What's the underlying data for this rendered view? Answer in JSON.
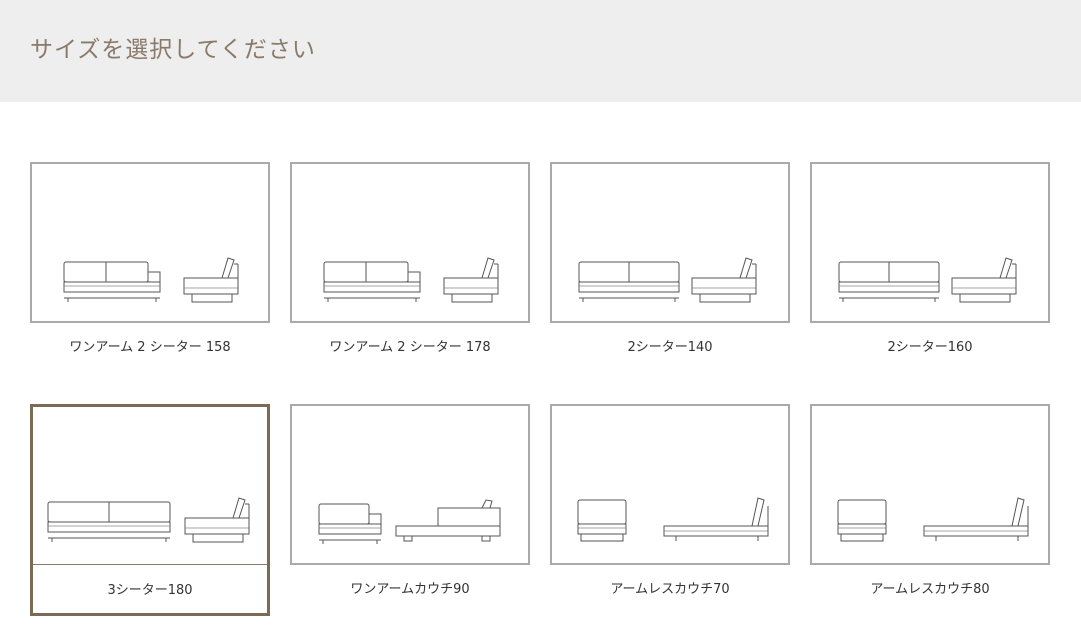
{
  "header": {
    "title": "サイズを選択してください"
  },
  "colors": {
    "accent": "#7d6a55",
    "title": "#8a7a6a",
    "border": "#aaaaaa"
  },
  "sizes": [
    {
      "label": "ワンアーム 2 シーター 158",
      "variant": "onearm2",
      "selected": false
    },
    {
      "label": "ワンアーム 2 シーター 178",
      "variant": "onearm2",
      "selected": false
    },
    {
      "label": "2シーター140",
      "variant": "seater2",
      "selected": false
    },
    {
      "label": "2シーター160",
      "variant": "seater2",
      "selected": false
    },
    {
      "label": "3シーター180",
      "variant": "seater3",
      "selected": true
    },
    {
      "label": "ワンアームカウチ90",
      "variant": "onearmcouch",
      "selected": false
    },
    {
      "label": "アームレスカウチ70",
      "variant": "armlesscouch",
      "selected": false
    },
    {
      "label": "アームレスカウチ80",
      "variant": "armlesscouch",
      "selected": false
    }
  ]
}
